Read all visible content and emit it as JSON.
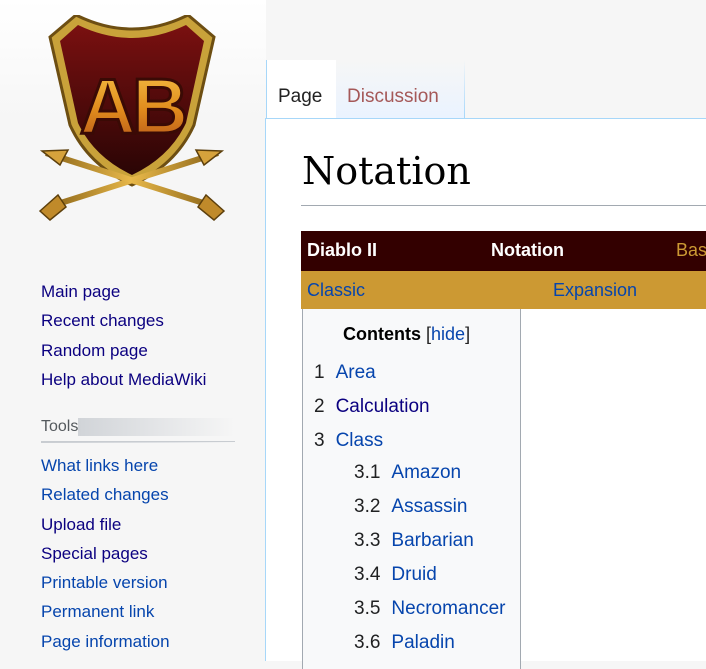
{
  "logo": {
    "text": "AB"
  },
  "navigation": {
    "items": [
      {
        "label": "Main page",
        "visited": true
      },
      {
        "label": "Recent changes",
        "visited": true
      },
      {
        "label": "Random page",
        "visited": true
      },
      {
        "label": "Help about MediaWiki",
        "visited": true
      }
    ]
  },
  "tools": {
    "heading": "Tools",
    "items": [
      {
        "label": "What links here",
        "visited": false
      },
      {
        "label": "Related changes",
        "visited": false
      },
      {
        "label": "Upload file",
        "visited": true
      },
      {
        "label": "Special pages",
        "visited": true
      },
      {
        "label": "Printable version",
        "visited": false
      },
      {
        "label": "Permanent link",
        "visited": false
      },
      {
        "label": "Page information",
        "visited": false
      }
    ]
  },
  "tabs": {
    "page": "Page",
    "discussion": "Discussion"
  },
  "article": {
    "title": "Notation"
  },
  "navbox": {
    "row1": {
      "left": "Diablo II",
      "center": "Notation",
      "right": "Bas"
    },
    "row2": {
      "classic": "Classic",
      "expansion": "Expansion"
    }
  },
  "toc": {
    "title": "Contents",
    "bracket_open": "[",
    "toggle": "hide",
    "bracket_close": "]",
    "items": [
      {
        "num": "1",
        "text": "Area"
      },
      {
        "num": "2",
        "text": "Calculation"
      },
      {
        "num": "3",
        "text": "Class"
      },
      {
        "num": "3.1",
        "text": "Amazon"
      },
      {
        "num": "3.2",
        "text": "Assassin"
      },
      {
        "num": "3.3",
        "text": "Barbarian"
      },
      {
        "num": "3.4",
        "text": "Druid"
      },
      {
        "num": "3.5",
        "text": "Necromancer"
      },
      {
        "num": "3.6",
        "text": "Paladin"
      }
    ]
  },
  "colors": {
    "link": "#0645ad",
    "link_visited": "#0b0080",
    "navbox_dark": "#330000",
    "navbox_gold": "#cc9933",
    "tab_discussion": "#a55858"
  }
}
